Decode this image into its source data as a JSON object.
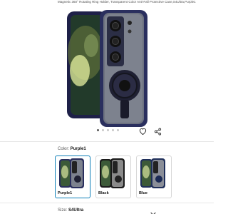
{
  "product": {
    "description": "Magnetic 360° Rotating Ring Holder, Transparent Color Anti-Fall Protective Case,S4Ultra,Purple1"
  },
  "gallery": {
    "dots": [
      true,
      false,
      false,
      false,
      false
    ]
  },
  "icons": {
    "favorite": "heart-icon",
    "share": "share-icon",
    "expand": "chevron-down-icon"
  },
  "color": {
    "label": "Color:",
    "selected": "Purple1",
    "options": [
      {
        "label": "Purple1",
        "frame": "#2a2f5e",
        "selected": true
      },
      {
        "label": "Black",
        "frame": "#1a1a1a",
        "selected": false
      },
      {
        "label": "Blue",
        "frame": "#1f2f5a",
        "selected": false
      }
    ]
  },
  "size": {
    "label": "Size:",
    "selected": "S4Ultra"
  },
  "colors": {
    "accent": "#0e7fb8",
    "case_purple": "#2a2f5e"
  }
}
